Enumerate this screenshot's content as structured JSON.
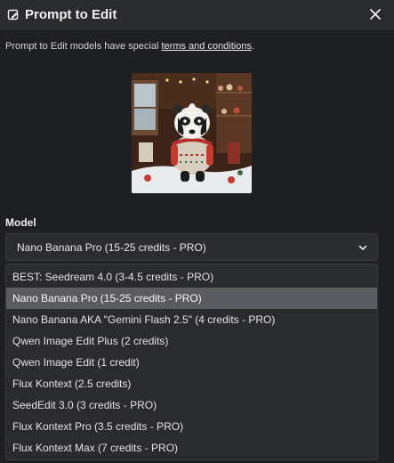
{
  "dialog": {
    "title": "Prompt to Edit",
    "notice_prefix": "Prompt to Edit models have special ",
    "notice_link": "terms and conditions",
    "notice_suffix": "."
  },
  "model": {
    "label": "Model",
    "selected": "Nano Banana Pro (15-25 credits - PRO)",
    "options": [
      {
        "label": "BEST: Seedream 4.0 (3-4.5 credits - PRO)",
        "selected": false
      },
      {
        "label": "Nano Banana Pro (15-25 credits - PRO)",
        "selected": true
      },
      {
        "label": "Nano Banana AKA \"Gemini Flash 2.5\" (4 credits - PRO)",
        "selected": false
      },
      {
        "label": "Qwen Image Edit Plus (2 credits)",
        "selected": false
      },
      {
        "label": "Qwen Image Edit (1 credit)",
        "selected": false
      },
      {
        "label": "Flux Kontext (2.5 credits)",
        "selected": false
      },
      {
        "label": "SeedEdit 3.0 (3 credits - PRO)",
        "selected": false
      },
      {
        "label": "Flux Kontext Pro (3.5 credits - PRO)",
        "selected": false
      },
      {
        "label": "Flux Kontext Max (7 credits - PRO)",
        "selected": false
      }
    ]
  },
  "icons": {
    "title_icon": "edit-note-icon",
    "close_icon": "close-icon",
    "dropdown_icon": "chevron-down-icon"
  },
  "colors": {
    "background": "#1e1f22",
    "header": "#2a2b2e",
    "selected_option": "#5a5b61"
  }
}
